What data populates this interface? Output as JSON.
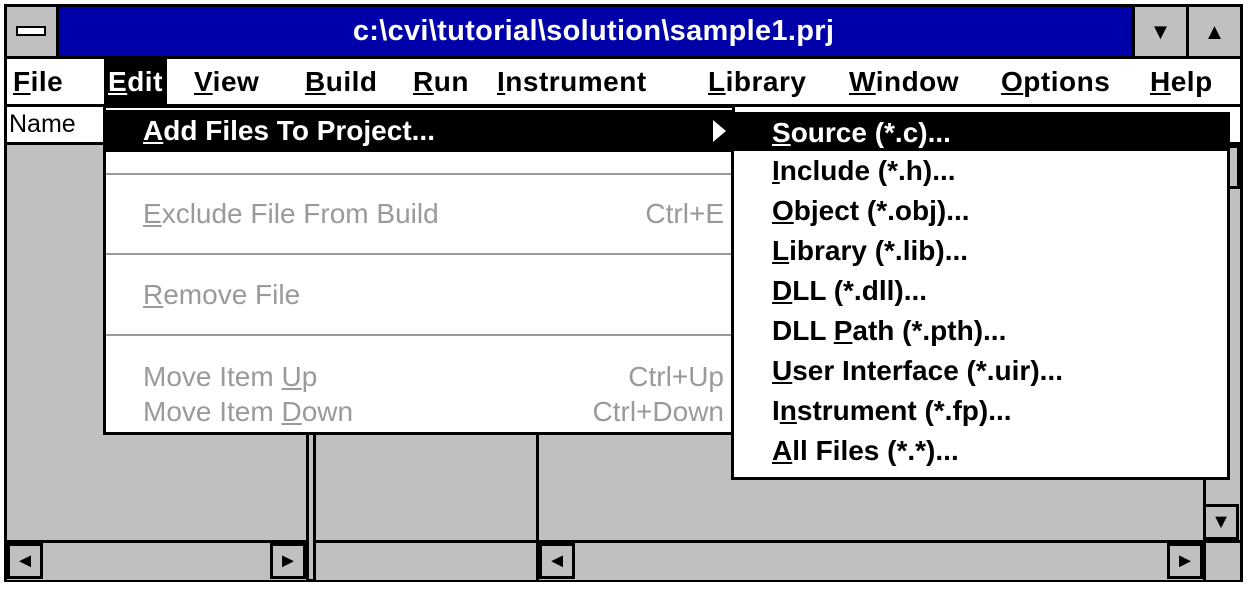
{
  "window": {
    "title": "c:\\cvi\\tutorial\\solution\\sample1.prj",
    "minimize_symbol": "▼",
    "maximize_symbol": "▲"
  },
  "menubar": {
    "items": [
      {
        "mnemonic": "F",
        "rest": "ile"
      },
      {
        "mnemonic": "E",
        "rest": "dit"
      },
      {
        "mnemonic": "V",
        "rest": "iew"
      },
      {
        "mnemonic": "B",
        "rest": "uild"
      },
      {
        "mnemonic": "R",
        "rest": "un"
      },
      {
        "mnemonic": "I",
        "rest": "nstrument"
      },
      {
        "mnemonic": "L",
        "rest": "ibrary"
      },
      {
        "mnemonic": "W",
        "rest": "indow"
      },
      {
        "mnemonic": "O",
        "rest": "ptions"
      },
      {
        "mnemonic": "H",
        "rest": "elp"
      }
    ]
  },
  "column_header": {
    "name": "Name"
  },
  "edit_menu": {
    "add_files": {
      "mnemonic": "A",
      "rest": "dd Files To Project..."
    },
    "exclude": {
      "mnemonic": "E",
      "rest": "xclude File From Build",
      "shortcut": "Ctrl+E"
    },
    "remove": {
      "mnemonic": "R",
      "rest": "emove File"
    },
    "move_up": {
      "pre": "Move Item ",
      "mnemonic": "U",
      "rest": "p",
      "shortcut": "Ctrl+Up"
    },
    "move_down": {
      "pre": "Move Item ",
      "mnemonic": "D",
      "rest": "own",
      "shortcut": "Ctrl+Down"
    }
  },
  "add_files_submenu": {
    "items": [
      {
        "pre": "",
        "mnemonic": "S",
        "rest": "ource (*.c)..."
      },
      {
        "pre": "",
        "mnemonic": "I",
        "rest": "nclude (*.h)..."
      },
      {
        "pre": "",
        "mnemonic": "O",
        "rest": "bject (*.obj)..."
      },
      {
        "pre": "",
        "mnemonic": "L",
        "rest": "ibrary (*.lib)..."
      },
      {
        "pre": "",
        "mnemonic": "D",
        "rest": "LL (*.dll)..."
      },
      {
        "pre": "DLL ",
        "mnemonic": "P",
        "rest": "ath (*.pth)..."
      },
      {
        "pre": "",
        "mnemonic": "U",
        "rest": "ser Interface (*.uir)..."
      },
      {
        "pre": "I",
        "mnemonic": "n",
        "rest": "strument (*.fp)..."
      },
      {
        "pre": "",
        "mnemonic": "A",
        "rest": "ll Files (*.*)..."
      }
    ]
  },
  "scrollbars": {
    "left_symbol": "◄",
    "right_symbol": "►",
    "down_symbol": "▼"
  }
}
